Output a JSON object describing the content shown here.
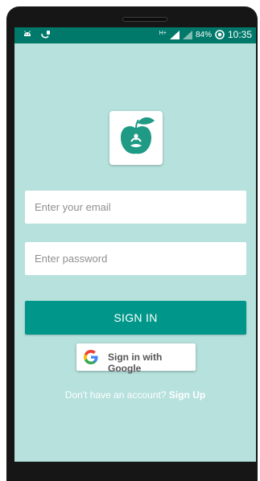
{
  "status_bar": {
    "network": "H+",
    "battery": "84%",
    "time": "10:35"
  },
  "icons": {
    "status_left": [
      "android-icon",
      "notification-icon"
    ],
    "logo": "apple-meditation-logo-icon",
    "google": "google-g-icon"
  },
  "colors": {
    "status_bar": "#00796b",
    "screen_background": "#b6e1dd",
    "primary_button": "#00978a",
    "logo_green": "#1e9a85"
  },
  "login": {
    "email_placeholder": "Enter your email",
    "password_placeholder": "Enter password",
    "signin_label": "SIGN IN",
    "google_label": "Sign in with Google",
    "signup_prompt": "Don't have an account?",
    "signup_link": "Sign Up"
  }
}
